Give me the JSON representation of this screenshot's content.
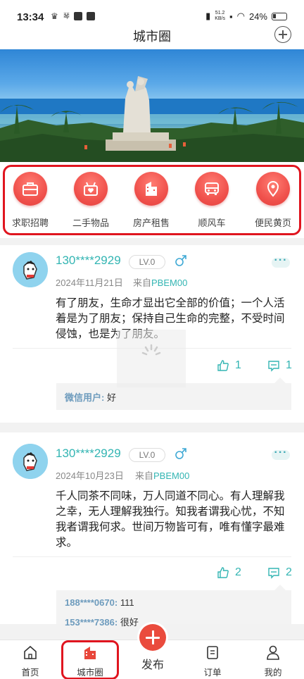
{
  "status_bar": {
    "time": "13:34",
    "left_icons": [
      "crown-icon",
      "琴",
      "sync-icon",
      "app-icon"
    ],
    "network_speed": "51.2",
    "network_unit": "KB/s",
    "battery": "24%"
  },
  "header": {
    "title": "城市圈"
  },
  "categories": [
    {
      "label": "求职招聘",
      "icon": "briefcase-icon"
    },
    {
      "label": "二手物品",
      "icon": "gift-box-icon"
    },
    {
      "label": "房产租售",
      "icon": "building-icon"
    },
    {
      "label": "顺风车",
      "icon": "car-icon"
    },
    {
      "label": "便民黄页",
      "icon": "location-pin-icon"
    }
  ],
  "posts": [
    {
      "user": "130****2929",
      "level": "LV.0",
      "gender": "male",
      "date": "2024年11月21日",
      "from_prefix": "来自",
      "from": "PBEM00",
      "content": "有了朋友，生命才显出它全部的价值；一个人活着是为了朋友；保持自己生命的完整，不受时间侵蚀，也是为了朋友。",
      "likes": "1",
      "comments": "1",
      "comment_list": [
        {
          "user": "微信用户:",
          "text": "好"
        }
      ]
    },
    {
      "user": "130****2929",
      "level": "LV.0",
      "gender": "male",
      "date": "2024年10月23日",
      "from_prefix": "来自",
      "from": "PBEM00",
      "content": "千人同茶不同味，万人同道不同心。有人理解我之幸，无人理解我独行。知我者谓我心忧，不知我者谓我何求。世间万物皆可有，唯有懂字最难求。",
      "likes": "2",
      "comments": "2",
      "comment_list": [
        {
          "user": "188****0670:",
          "text": "111"
        },
        {
          "user": "153****7386:",
          "text": "很好"
        }
      ]
    }
  ],
  "tabbar": {
    "items": [
      {
        "label": "首页",
        "icon": "home-icon"
      },
      {
        "label": "城市圈",
        "icon": "city-icon"
      },
      {
        "label": "订单",
        "icon": "order-icon"
      },
      {
        "label": "我的",
        "icon": "user-icon"
      }
    ],
    "publish_label": "发布"
  },
  "colors": {
    "accent": "#33b5b3",
    "category": "#f0514c",
    "highlight_frame": "#e0151f"
  }
}
